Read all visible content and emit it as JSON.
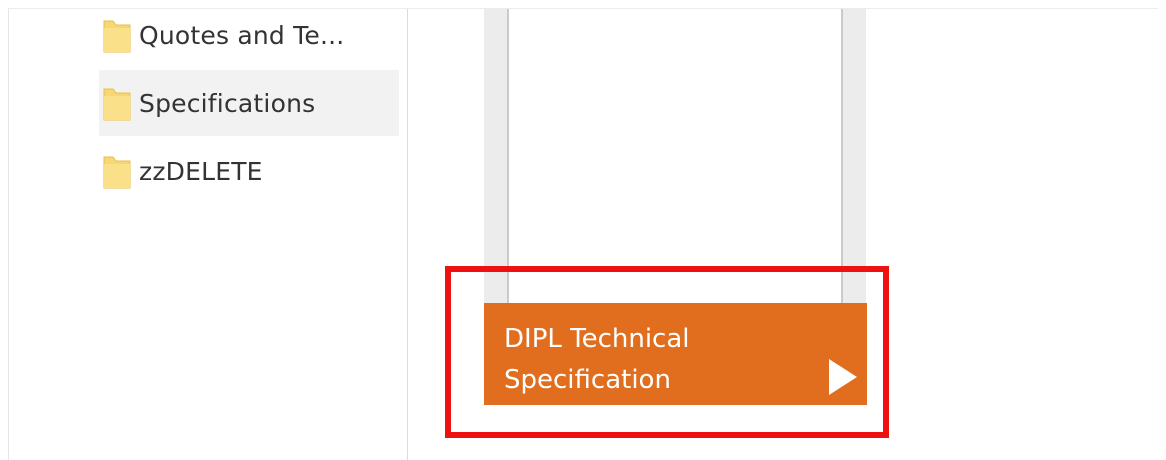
{
  "folder_tree": {
    "items": [
      {
        "label": "Quotes and Te...",
        "icon": "folder-icon",
        "selected": false
      },
      {
        "label": "Specifications",
        "icon": "folder-icon",
        "selected": true
      },
      {
        "label": "zzDELETE",
        "icon": "folder-icon",
        "selected": false
      }
    ]
  },
  "action_tile": {
    "title_line1": "DIPL Technical",
    "title_line2": "Specification",
    "icon": "play-icon"
  },
  "colors": {
    "folder": "#f7d774",
    "folder_edge": "#e8bd4a",
    "tile_background": "#e06e1e",
    "highlight": "#ee1111",
    "selected_row": "#f2f2f2"
  }
}
